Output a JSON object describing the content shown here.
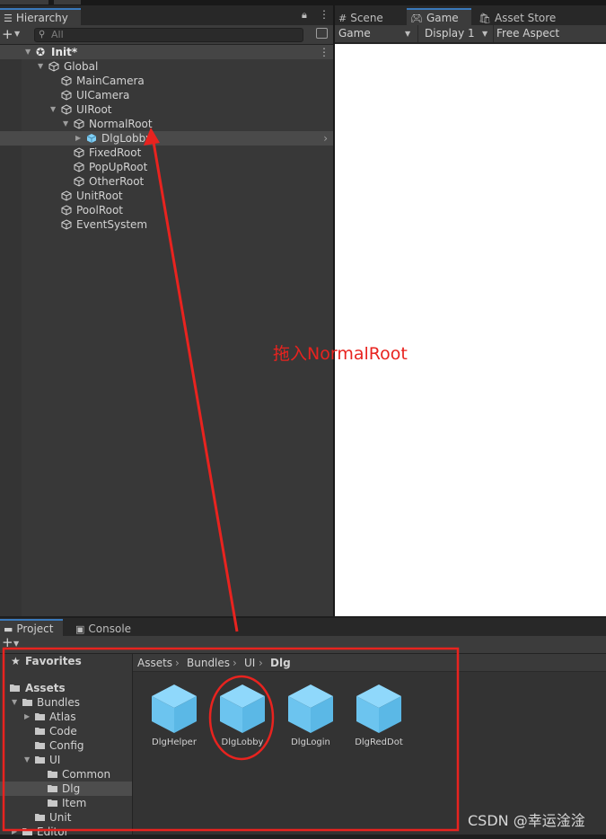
{
  "hierarchy": {
    "tab_label": "Hierarchy",
    "search_placeholder": "All",
    "scene": "Init*",
    "items": [
      {
        "label": "Global",
        "expanded": true
      },
      {
        "label": "MainCamera"
      },
      {
        "label": "UICamera"
      },
      {
        "label": "UIRoot",
        "expanded": true
      },
      {
        "label": "NormalRoot",
        "expanded": true
      },
      {
        "label": "DlgLobby",
        "prefab": true,
        "selected": true
      },
      {
        "label": "FixedRoot"
      },
      {
        "label": "PopUpRoot"
      },
      {
        "label": "OtherRoot"
      },
      {
        "label": "UnitRoot"
      },
      {
        "label": "PoolRoot"
      },
      {
        "label": "EventSystem"
      }
    ]
  },
  "game_view": {
    "tabs": [
      "Scene",
      "Game",
      "Asset Store"
    ],
    "active_tab": "Game",
    "toolbar": {
      "mode": "Game",
      "display": "Display 1",
      "aspect": "Free Aspect"
    }
  },
  "project": {
    "tabs": [
      "Project",
      "Console"
    ],
    "active_tab": "Project",
    "tree": {
      "favorites": "Favorites",
      "assets": "Assets",
      "folders": [
        {
          "label": "Bundles",
          "expanded": true
        },
        {
          "label": "Atlas"
        },
        {
          "label": "Code"
        },
        {
          "label": "Config"
        },
        {
          "label": "UI",
          "expanded": true
        },
        {
          "label": "Common"
        },
        {
          "label": "Dlg",
          "selected": true
        },
        {
          "label": "Item"
        },
        {
          "label": "Unit"
        },
        {
          "label": "Editor"
        }
      ]
    },
    "breadcrumb": [
      "Assets",
      "Bundles",
      "UI",
      "Dlg"
    ],
    "assets": [
      "DlgHelper",
      "DlgLobby",
      "DlgLogin",
      "DlgRedDot"
    ]
  },
  "annotation": {
    "text": "拖入NormalRoot",
    "color": "#e8231f"
  },
  "watermark": "CSDN @幸运淦淦"
}
